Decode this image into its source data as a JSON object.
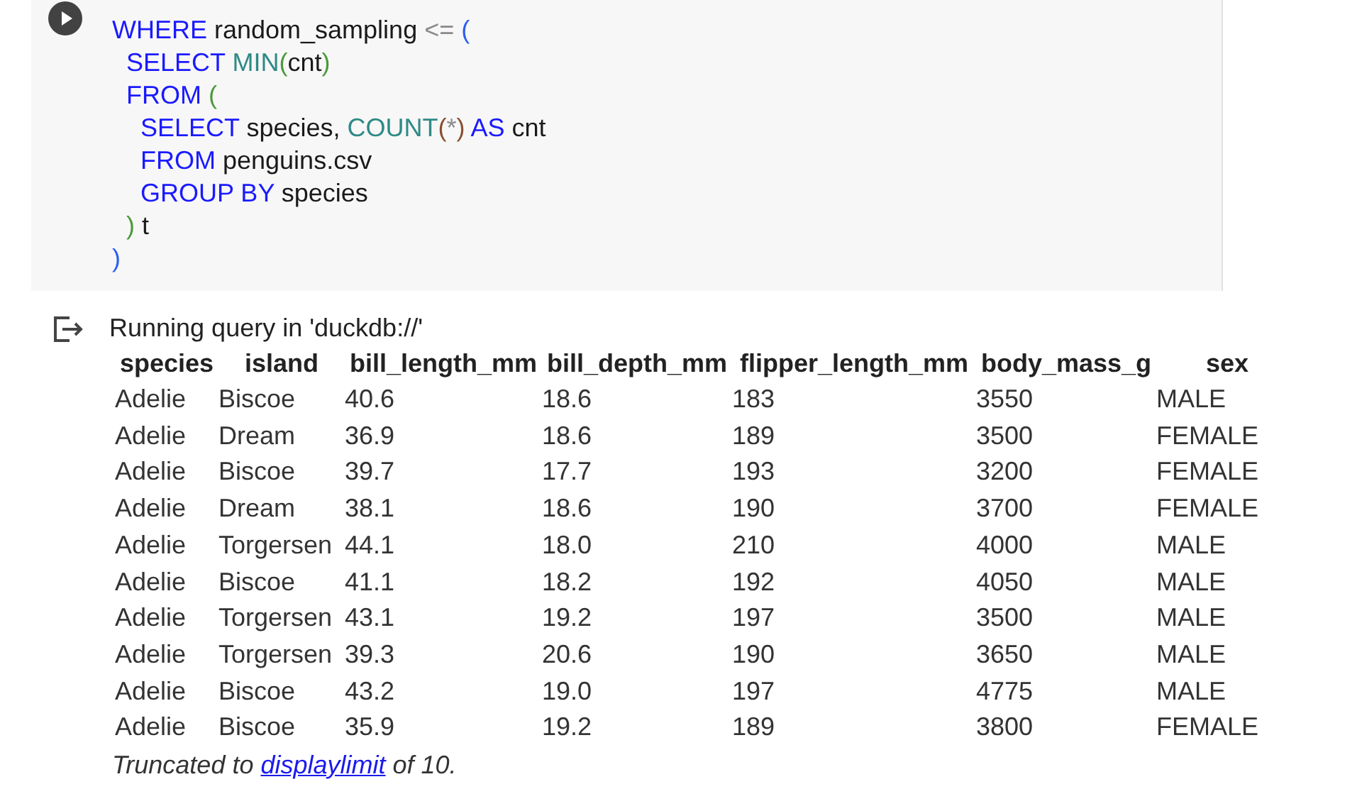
{
  "code_cell": {
    "lines": [
      [
        {
          "kind": "keyword",
          "text": "WHERE"
        },
        {
          "kind": "plain",
          "text": " random_sampling "
        },
        {
          "kind": "operator",
          "text": "<="
        },
        {
          "kind": "bracket",
          "text": " ("
        }
      ],
      [
        {
          "kind": "keyword",
          "text": "  SELECT "
        },
        {
          "kind": "builtin",
          "text": "MIN"
        },
        {
          "kind": "bracket2",
          "text": "("
        },
        {
          "kind": "plain",
          "text": "cnt"
        },
        {
          "kind": "bracket2",
          "text": ")"
        }
      ],
      [
        {
          "kind": "keyword",
          "text": "  FROM "
        },
        {
          "kind": "bracket2",
          "text": "("
        }
      ],
      [
        {
          "kind": "keyword",
          "text": "    SELECT"
        },
        {
          "kind": "plain",
          "text": " species, "
        },
        {
          "kind": "builtin",
          "text": "COUNT"
        },
        {
          "kind": "bracket3",
          "text": "("
        },
        {
          "kind": "operator",
          "text": "*"
        },
        {
          "kind": "bracket3",
          "text": ")"
        },
        {
          "kind": "keyword",
          "text": " AS"
        },
        {
          "kind": "plain",
          "text": " cnt"
        }
      ],
      [
        {
          "kind": "keyword",
          "text": "    FROM"
        },
        {
          "kind": "plain",
          "text": " penguins.csv"
        }
      ],
      [
        {
          "kind": "keyword",
          "text": "    GROUP BY"
        },
        {
          "kind": "plain",
          "text": " species"
        }
      ],
      [
        {
          "kind": "bracket2",
          "text": "  )"
        },
        {
          "kind": "plain",
          "text": " t"
        }
      ],
      [
        {
          "kind": "bracket",
          "text": ")"
        }
      ]
    ]
  },
  "output": {
    "status": "Running query in 'duckdb://'",
    "table": {
      "columns": [
        "species",
        "island",
        "bill_length_mm",
        "bill_depth_mm",
        "flipper_length_mm",
        "body_mass_g",
        "sex"
      ],
      "rows": [
        [
          "Adelie",
          "Biscoe",
          "40.6",
          "18.6",
          "183",
          "3550",
          "MALE"
        ],
        [
          "Adelie",
          "Dream",
          "36.9",
          "18.6",
          "189",
          "3500",
          "FEMALE"
        ],
        [
          "Adelie",
          "Biscoe",
          "39.7",
          "17.7",
          "193",
          "3200",
          "FEMALE"
        ],
        [
          "Adelie",
          "Dream",
          "38.1",
          "18.6",
          "190",
          "3700",
          "FEMALE"
        ],
        [
          "Adelie",
          "Torgersen",
          "44.1",
          "18.0",
          "210",
          "4000",
          "MALE"
        ],
        [
          "Adelie",
          "Biscoe",
          "41.1",
          "18.2",
          "192",
          "4050",
          "MALE"
        ],
        [
          "Adelie",
          "Torgersen",
          "43.1",
          "19.2",
          "197",
          "3500",
          "MALE"
        ],
        [
          "Adelie",
          "Torgersen",
          "39.3",
          "20.6",
          "190",
          "3650",
          "MALE"
        ],
        [
          "Adelie",
          "Biscoe",
          "43.2",
          "19.0",
          "197",
          "4775",
          "MALE"
        ],
        [
          "Adelie",
          "Biscoe",
          "35.9",
          "19.2",
          "189",
          "3800",
          "FEMALE"
        ]
      ]
    },
    "note": {
      "before": "Truncated to ",
      "link": "displaylimit",
      "after": " of 10."
    }
  }
}
